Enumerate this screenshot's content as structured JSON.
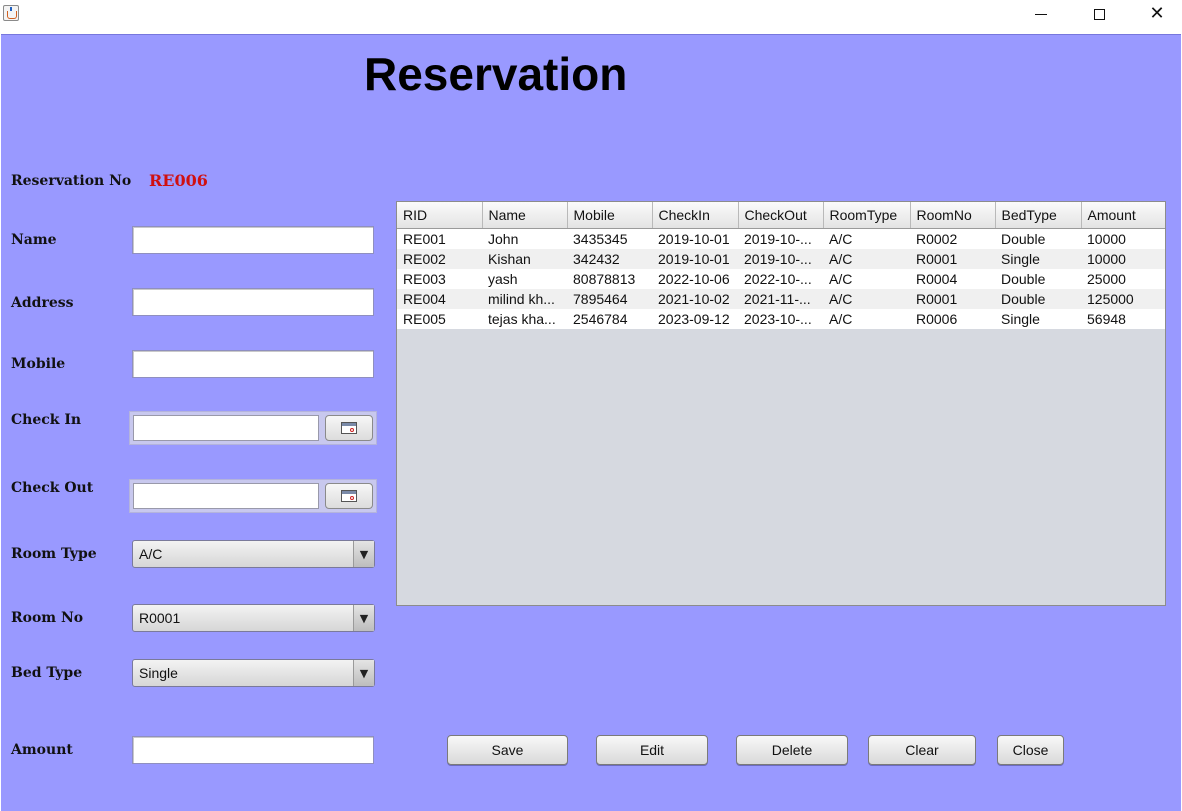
{
  "window": {
    "app_icon": "java-cup-icon",
    "minimize_icon": "minimize-icon",
    "maximize_icon": "maximize-icon",
    "close_icon": "close-icon",
    "close_glyph": "✕"
  },
  "form": {
    "title": "Reservation",
    "reservation_no_label": "Reservation No",
    "reservation_no_value": "RE006",
    "name_label": "Name",
    "name_value": "",
    "address_label": "Address",
    "address_value": "",
    "mobile_label": "Mobile",
    "mobile_value": "",
    "check_in_label": "Check In",
    "check_in_value": "",
    "check_out_label": "Check Out",
    "check_out_value": "",
    "room_type_label": "Room Type",
    "room_type_value": "A/C",
    "room_no_label": "Room No",
    "room_no_value": "R0001",
    "bed_type_label": "Bed Type",
    "bed_type_value": "Single",
    "amount_label": "Amount",
    "amount_value": "",
    "combo_arrow": "▼"
  },
  "table": {
    "columns": [
      "RID",
      "Name",
      "Mobile",
      "CheckIn",
      "CheckOut",
      "RoomType",
      "RoomNo",
      "BedType",
      "Amount"
    ],
    "rows": [
      [
        "RE001",
        "John",
        "3435345",
        "2019-10-01",
        "2019-10-...",
        "A/C",
        "R0002",
        "Double",
        "10000"
      ],
      [
        "RE002",
        "Kishan",
        "342432",
        "2019-10-01",
        "2019-10-...",
        "A/C",
        "R0001",
        "Single",
        "10000"
      ],
      [
        "RE003",
        "yash",
        "80878813",
        "2022-10-06",
        "2022-10-...",
        "A/C",
        "R0004",
        "Double",
        "25000"
      ],
      [
        "RE004",
        "milind kh...",
        "7895464",
        "2021-10-02",
        "2021-11-...",
        "A/C",
        "R0001",
        "Double",
        "125000"
      ],
      [
        "RE005",
        "tejas kha...",
        "2546784",
        "2023-09-12",
        "2023-10-...",
        "A/C",
        "R0006",
        "Single",
        "56948"
      ]
    ]
  },
  "buttons": {
    "save": "Save",
    "edit": "Edit",
    "delete": "Delete",
    "clear": "Clear",
    "close": "Close"
  },
  "colors": {
    "panel_bg": "#9999ff",
    "reservation_no": "#d01010"
  },
  "icons": {
    "calendar": "calendar-icon"
  }
}
